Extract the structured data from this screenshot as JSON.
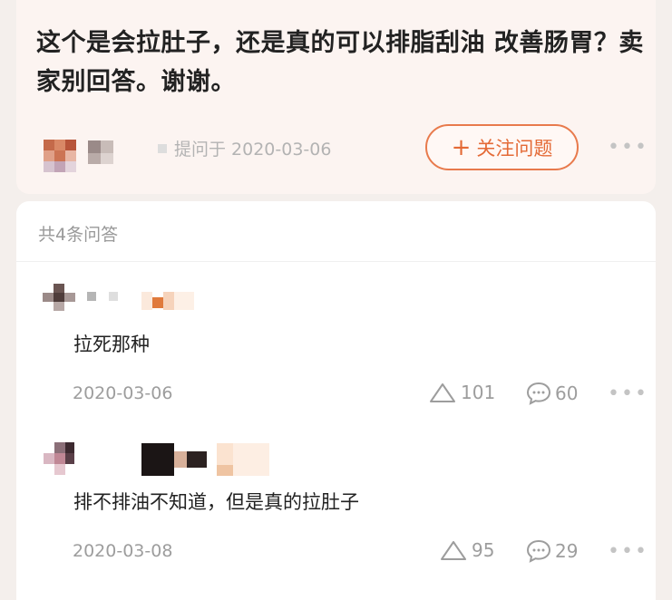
{
  "question": {
    "title": "这个是会拉肚子，还是真的可以排脂刮油 改善肠胃？卖家别回答。谢谢。",
    "asked_time": "提问于 2020-03-06",
    "follow_label": "关注问题",
    "follow_icon": "plus-icon"
  },
  "answers_count": "共4条问答",
  "answers": [
    {
      "text": "拉死那种",
      "date": "2020-03-06",
      "likes": "101",
      "comments": "60"
    },
    {
      "text": "排不排油不知道，但是真的拉肚子",
      "date": "2020-03-08",
      "likes": "95",
      "comments": "29"
    }
  ],
  "colors": {
    "accent": "#e46a36",
    "muted": "#9d9d9d"
  }
}
